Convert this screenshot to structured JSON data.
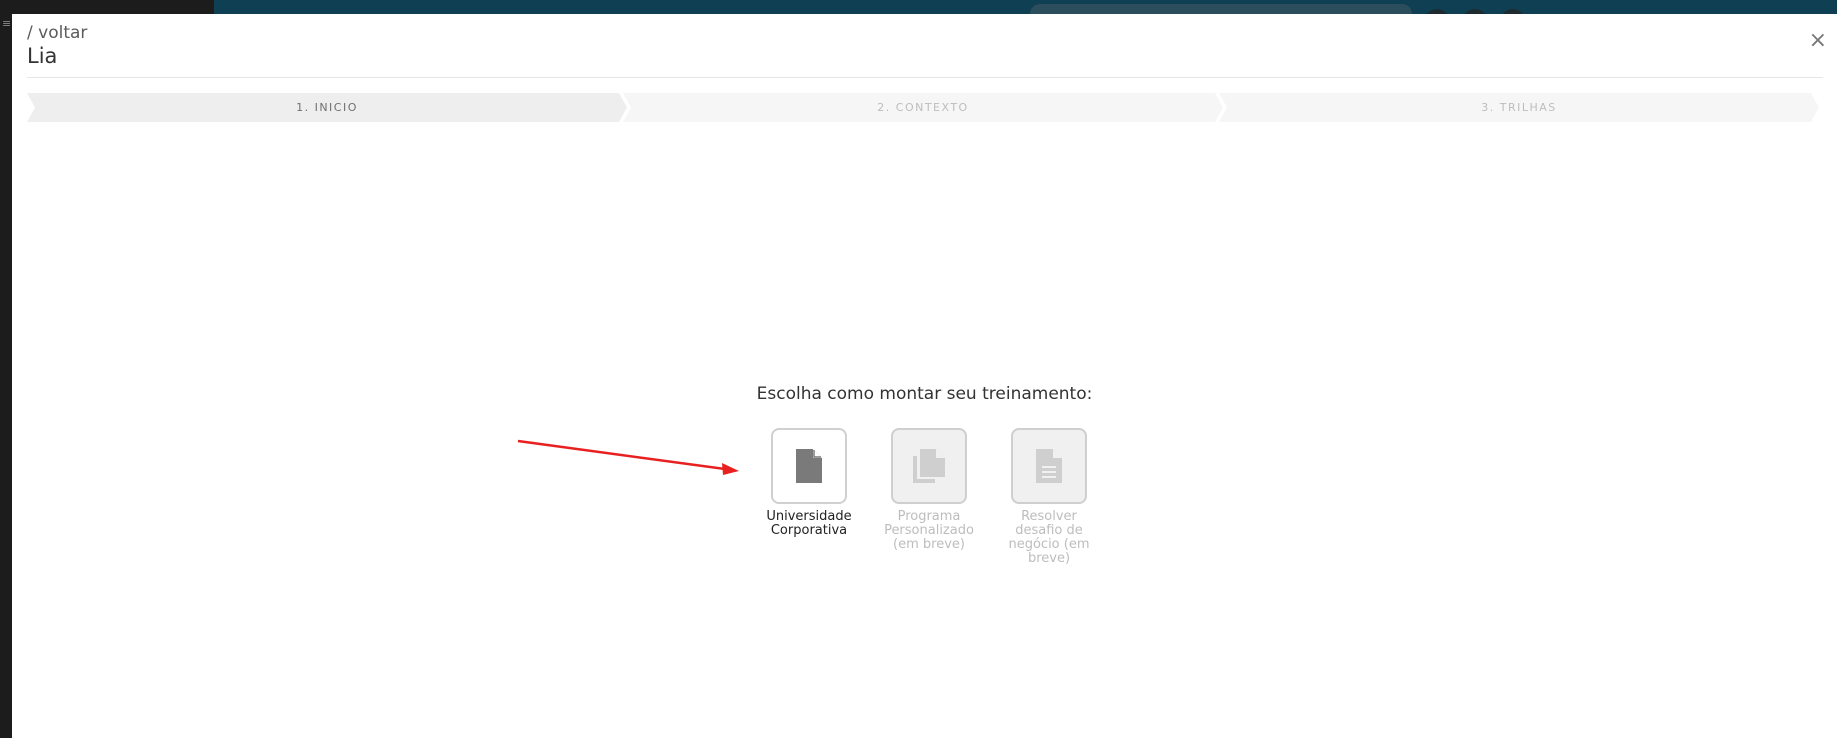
{
  "modal": {
    "back_label": "/ voltar",
    "title": "Lia",
    "close_glyph": "×"
  },
  "steps": [
    {
      "label": "1. INICIO",
      "state": "active"
    },
    {
      "label": "2. CONTEXTO",
      "state": "inactive"
    },
    {
      "label": "3. TRILHAS",
      "state": "inactive"
    }
  ],
  "main": {
    "prompt": "Escolha como montar seu treinamento:",
    "options": [
      {
        "label_line1": "Universidade",
        "label_line2": "Corporativa",
        "label_line3": "",
        "label_line4": "",
        "icon": "document-icon",
        "enabled": true
      },
      {
        "label_line1": "Programa",
        "label_line2": "Personalizado",
        "label_line3": "(em breve)",
        "label_line4": "",
        "icon": "copy-documents-icon",
        "enabled": false
      },
      {
        "label_line1": "Resolver",
        "label_line2": "desafio de",
        "label_line3": "negócio (em",
        "label_line4": "breve)",
        "icon": "text-document-icon",
        "enabled": false
      }
    ]
  },
  "colors": {
    "annotation_arrow": "#e82020",
    "app_topbar": "#0f3f52",
    "icon_active": "#7a7a7a",
    "icon_disabled": "#cfcfcf"
  }
}
